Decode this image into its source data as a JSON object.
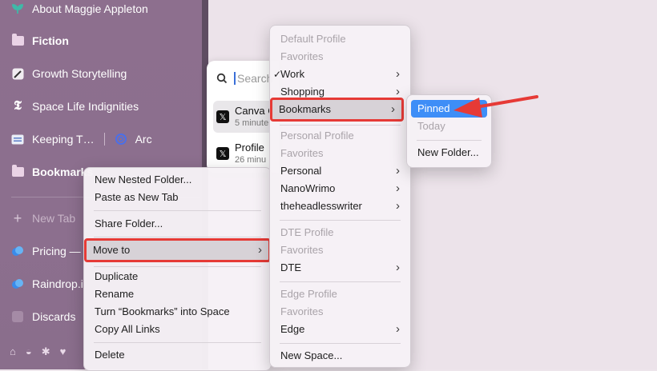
{
  "sidebar": {
    "items": [
      {
        "label": "About Maggie Appleton",
        "icon": "leaf-icon"
      },
      {
        "label": "Fiction",
        "icon": "folder-icon"
      },
      {
        "label": "Growth Storytelling",
        "icon": "pen-icon"
      },
      {
        "label": "Space Life Indignities",
        "icon": "nytimes-icon"
      },
      {
        "label": "Keeping T…",
        "icon": "keyboard-icon",
        "split_label": "Arc",
        "split_icon": "arc-icon"
      },
      {
        "label": "Bookmarks",
        "icon": "folder-icon"
      },
      {
        "label": "New Tab",
        "icon": "plus-icon"
      },
      {
        "label": "Pricing —",
        "icon": "cloud-icon"
      },
      {
        "label": "Raindrop.i",
        "icon": "raindrop-icon"
      },
      {
        "label": "Discards",
        "icon": "square-icon"
      }
    ]
  },
  "command_bar": {
    "placeholder": "Search",
    "results": [
      {
        "title": "Canva C",
        "subtitle": "5 minute"
      },
      {
        "title": "Profile",
        "subtitle": "26 minu"
      }
    ]
  },
  "context_menu": {
    "items": [
      "New Nested Folder...",
      "Paste as New Tab",
      "Share Folder...",
      "Move to",
      "Duplicate",
      "Rename",
      "Turn “Bookmarks” into Space",
      "Copy All Links",
      "Delete"
    ]
  },
  "move_to_menu": {
    "default_profile": "Default Profile",
    "favorites": "Favorites",
    "work": "Work",
    "shopping": "Shopping",
    "bookmarks": "Bookmarks",
    "personal_profile": "Personal Profile",
    "personal": "Personal",
    "nanowrimo": "NanoWrimo",
    "theheadlesswriter": "theheadlesswriter",
    "dte_profile": "DTE Profile",
    "dte": "DTE",
    "edge_profile": "Edge Profile",
    "edge": "Edge",
    "new_space": "New Space..."
  },
  "bookmarks_submenu": {
    "pinned": "Pinned",
    "today": "Today",
    "new_folder": "New Folder..."
  },
  "colors": {
    "sidebar": "#8d6f8e",
    "highlight_blue": "#3e8ef7",
    "annotation_red": "#e63a36"
  }
}
